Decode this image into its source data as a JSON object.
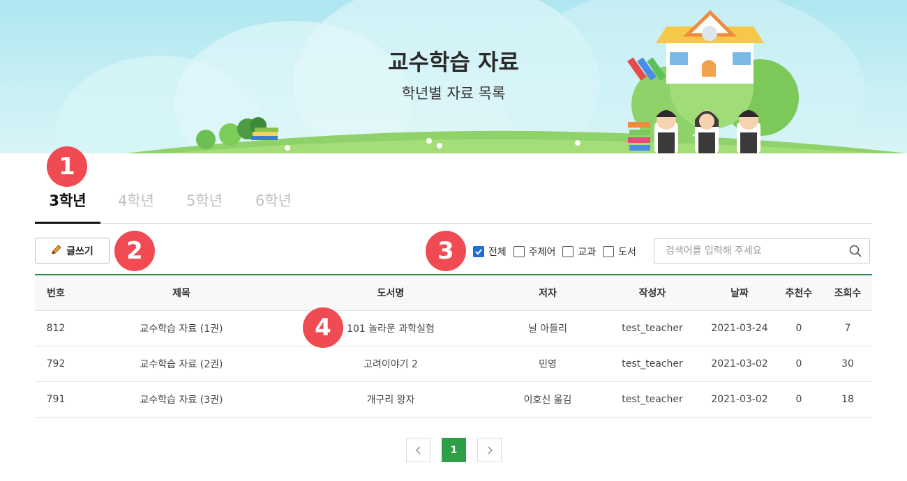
{
  "banner": {
    "title": "교수학습 자료",
    "subtitle": "학년별 자료 목록"
  },
  "badges": [
    "1",
    "2",
    "3",
    "4"
  ],
  "tabs": [
    {
      "label": "3학년",
      "active": true
    },
    {
      "label": "4학년",
      "active": false
    },
    {
      "label": "5학년",
      "active": false
    },
    {
      "label": "6학년",
      "active": false
    }
  ],
  "toolbar": {
    "write_label": "글쓰기",
    "write_icon": "pencil-icon",
    "filters": [
      {
        "label": "전체",
        "checked": true
      },
      {
        "label": "주제어",
        "checked": false
      },
      {
        "label": "교과",
        "checked": false
      },
      {
        "label": "도서",
        "checked": false
      }
    ],
    "search_placeholder": "검색어를 입력해 주세요",
    "search_icon": "search-icon"
  },
  "table": {
    "headers": [
      "번호",
      "제목",
      "도서명",
      "저자",
      "작성자",
      "날짜",
      "추천수",
      "조회수"
    ],
    "rows": [
      [
        "812",
        "교수학습 자료 (1권)",
        "101 놀라운 과학실험",
        "닐 아들리",
        "test_teacher",
        "2021-03-24",
        "0",
        "7"
      ],
      [
        "792",
        "교수학습 자료 (2권)",
        "고려이야기 2",
        "민영",
        "test_teacher",
        "2021-03-02",
        "0",
        "30"
      ],
      [
        "791",
        "교수학습 자료 (3권)",
        "개구리 왕자",
        "이호신 옮김",
        "test_teacher",
        "2021-03-02",
        "0",
        "18"
      ]
    ]
  },
  "pagination": {
    "pages": [
      "1"
    ],
    "current": "1",
    "prev_icon": "chevron-left-icon",
    "next_icon": "chevron-right-icon"
  },
  "colors": {
    "accent_green": "#2e9e47",
    "badge_red": "#f04a52",
    "checkbox_blue": "#1e6fd6"
  }
}
